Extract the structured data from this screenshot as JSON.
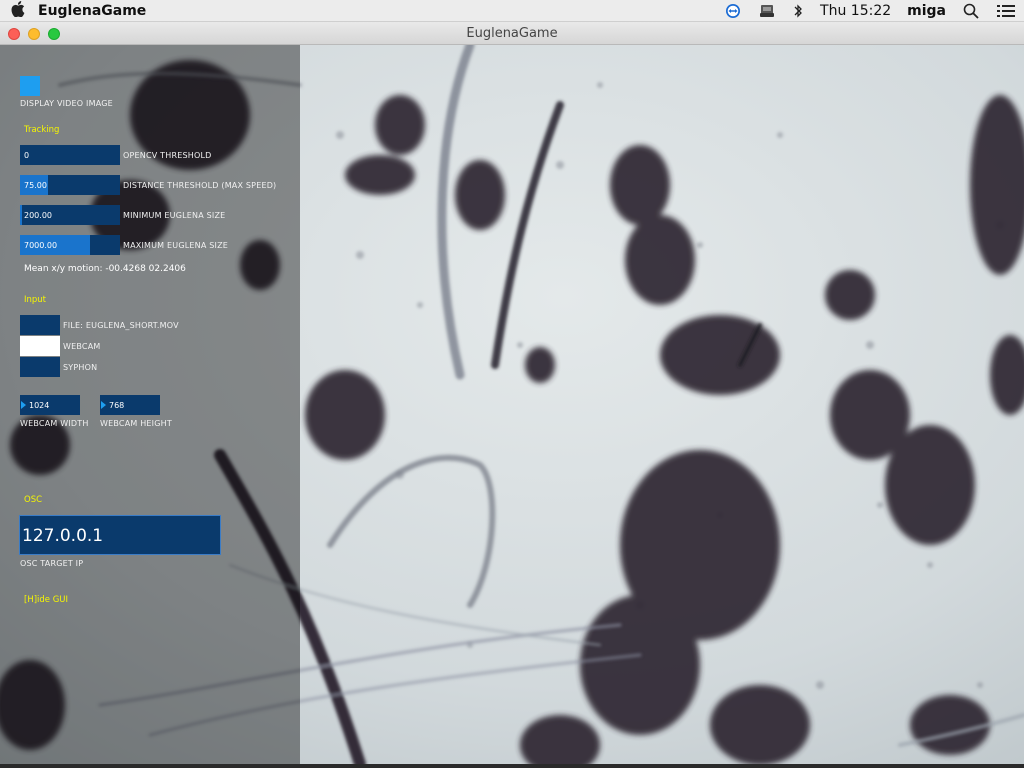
{
  "menubar": {
    "app_name": "EuglenaGame",
    "clock": "Thu 15:22",
    "user": "miga",
    "icons": [
      "apple-icon",
      "teamviewer-icon",
      "disk-icon",
      "bluetooth-icon",
      "search-icon",
      "list-icon"
    ]
  },
  "window": {
    "title": "EuglenaGame"
  },
  "gui": {
    "display_video": {
      "label": "DISPLAY VIDEO IMAGE",
      "checked": true
    },
    "tracking": {
      "header": "Tracking",
      "sliders": [
        {
          "label": "OPENCV THRESHOLD",
          "value": "0",
          "fill_fraction": 0.0
        },
        {
          "label": "DISTANCE THRESHOLD (MAX SPEED)",
          "value": "75.00",
          "fill_fraction": 0.28
        },
        {
          "label": "MINIMUM EUGLENA SIZE",
          "value": "200.00",
          "fill_fraction": 0.02
        },
        {
          "label": "MAXIMUM EUGLENA SIZE",
          "value": "7000.00",
          "fill_fraction": 0.7
        }
      ],
      "motion_text": "Mean x/y motion: -00.4268 02.2406"
    },
    "input": {
      "header": "Input",
      "options": [
        {
          "label": "FILE: EUGLENA_SHORT.MOV",
          "selected": false
        },
        {
          "label": "WEBCAM",
          "selected": true
        },
        {
          "label": "SYPHON",
          "selected": false
        }
      ],
      "webcam_width": {
        "label": "WEBCAM WIDTH",
        "value": "1024"
      },
      "webcam_height": {
        "label": "WEBCAM HEIGHT",
        "value": "768"
      }
    },
    "osc": {
      "header": "OSC",
      "target_ip": {
        "value": "127.0.0.1",
        "label": "OSC TARGET IP"
      }
    },
    "hide_gui": "[H]ide GUI"
  },
  "colors": {
    "accent": "#1e9ef0",
    "control_bg": "#0a3a6c",
    "slider_fill": "#1a74cc",
    "section_header": "#f5f500"
  }
}
